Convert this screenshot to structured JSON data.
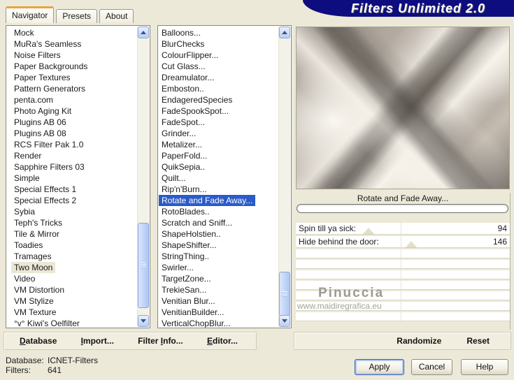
{
  "window": {
    "title": "Filters Unlimited 2.0"
  },
  "tabs": [
    {
      "label": "Navigator",
      "active": true
    },
    {
      "label": "Presets",
      "active": false
    },
    {
      "label": "About",
      "active": false
    }
  ],
  "category_list": {
    "items": [
      "Mock",
      "MuRa's Seamless",
      "Noise Filters",
      "Paper Backgrounds",
      "Paper Textures",
      "Pattern Generators",
      "penta.com",
      "Photo Aging Kit",
      "Plugins AB 06",
      "Plugins AB 08",
      "RCS Filter Pak 1.0",
      "Render",
      "Sapphire Filters 03",
      "Simple",
      "Special Effects 1",
      "Special Effects 2",
      "Sybia",
      "Teph's Tricks",
      "Tile & Mirror",
      "Toadies",
      "Tramages",
      "Two Moon",
      "Video",
      "VM Distortion",
      "VM Stylize",
      "VM Texture",
      "°v° Kiwi's Oelfilter"
    ],
    "selected": "Two Moon"
  },
  "filter_list": {
    "items": [
      "Balloons...",
      "BlurChecks",
      "ColourFlipper...",
      "Cut Glass...",
      "Dreamulator...",
      "Emboston..",
      "EndageredSpecies",
      "FadeSpookSpot...",
      "FadeSpot...",
      "Grinder...",
      "Metalizer...",
      "PaperFold...",
      "QuikSepia..",
      "Quilt...",
      "Rip'n'Burn...",
      "Rotate and Fade Away...",
      "RotoBlades..",
      "Scratch and Sniff...",
      "ShapeHolstien..",
      "ShapeShifter...",
      "StringThing..",
      "Swirler...",
      "TargetZone...",
      "TrekieSan...",
      "Venitian Blur...",
      "VenitianBuilder...",
      "VerticalChopBlur..."
    ],
    "selected": "Rotate and Fade Away..."
  },
  "preview": {
    "caption": "Rotate and Fade Away..."
  },
  "params": [
    {
      "label": "Spin till ya sick:",
      "value": "94",
      "thumb_pct": 34
    },
    {
      "label": "Hide behind the door:",
      "value": "146",
      "thumb_pct": 54
    }
  ],
  "watermark": {
    "name": "Pinuccia",
    "url": "www.maidiregrafica.eu"
  },
  "toolbar_left": [
    {
      "pre": "",
      "accel": "D",
      "rest": "atabase"
    },
    {
      "pre": "",
      "accel": "I",
      "rest": "mport..."
    },
    {
      "pre": "Filter ",
      "accel": "I",
      "rest": "nfo..."
    },
    {
      "pre": "",
      "accel": "E",
      "rest": "ditor..."
    }
  ],
  "toolbar_right": {
    "randomize": "Randomize",
    "reset": "Reset"
  },
  "status": {
    "database_label": "Database:",
    "database_value": "ICNET-Filters",
    "filters_label": "Filters:",
    "filters_value": "641"
  },
  "actions": {
    "apply": "Apply",
    "cancel": "Cancel",
    "help": "Help"
  },
  "colors": {
    "dialog_bg": "#ECE9D8",
    "banner_bg": "#0D0D80",
    "selection_bg": "#2B5BC8",
    "inactive_selection_bg": "#EBE7D6",
    "tab_accent": "#E8A33D",
    "scrollbar_accent": "#AEC7F4"
  }
}
